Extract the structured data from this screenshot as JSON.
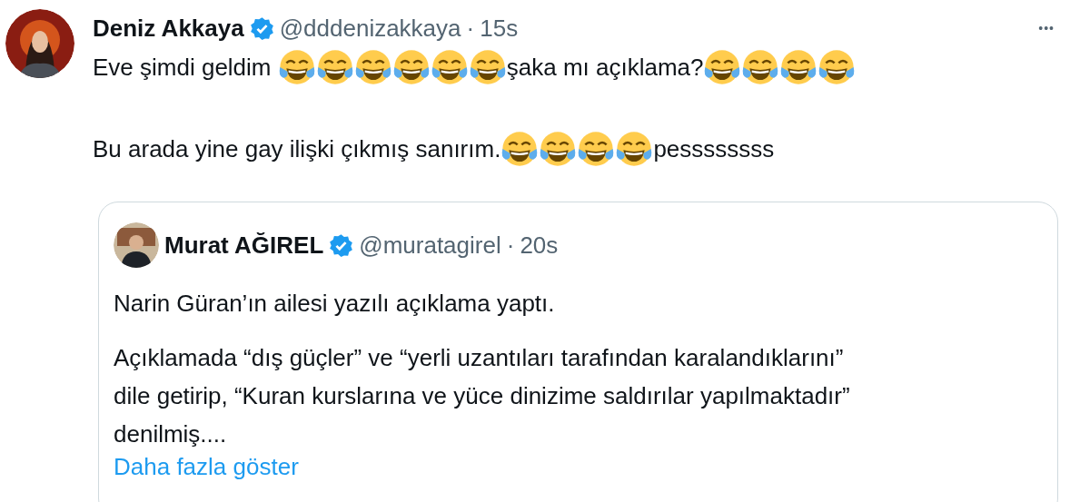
{
  "tweet": {
    "author": {
      "name": "Deniz Akkaya",
      "verified": true,
      "handle": "@dddenizakkaya",
      "dot": "·",
      "time": "15s"
    },
    "more": "•••",
    "lines": [
      [
        {
          "kind": "text",
          "text": "Eve şimdi geldim "
        },
        {
          "kind": "emoji"
        },
        {
          "kind": "emoji"
        },
        {
          "kind": "emoji"
        },
        {
          "kind": "emoji"
        },
        {
          "kind": "emoji"
        },
        {
          "kind": "emoji"
        },
        {
          "kind": "text",
          "text": "şaka mı açıklama?"
        },
        {
          "kind": "emoji"
        },
        {
          "kind": "emoji"
        },
        {
          "kind": "emoji"
        },
        {
          "kind": "emoji"
        }
      ],
      [
        {
          "kind": "text",
          "text": "Bu arada yine gay ilişki çıkmış sanırım."
        },
        {
          "kind": "emoji"
        },
        {
          "kind": "emoji"
        },
        {
          "kind": "emoji"
        },
        {
          "kind": "emoji"
        },
        {
          "kind": "text",
          "text": "pessssssss"
        }
      ]
    ],
    "quote": {
      "author": {
        "name": "Murat AĞIREL",
        "verified": true,
        "handle": "@muratagirel",
        "dot": "·",
        "time": "20s"
      },
      "paragraphs": [
        "Narin Güran’ın ailesi yazılı açıklama yaptı.",
        "Açıklamada “dış güçler” ve “yerli uzantıları tarafından karalandıklarını”\ndile getirip, “Kuran kurslarına ve yüce dinizime saldırılar yapılmaktadır”\ndenilmiş...."
      ],
      "show_more": "Daha fazla göster"
    }
  }
}
